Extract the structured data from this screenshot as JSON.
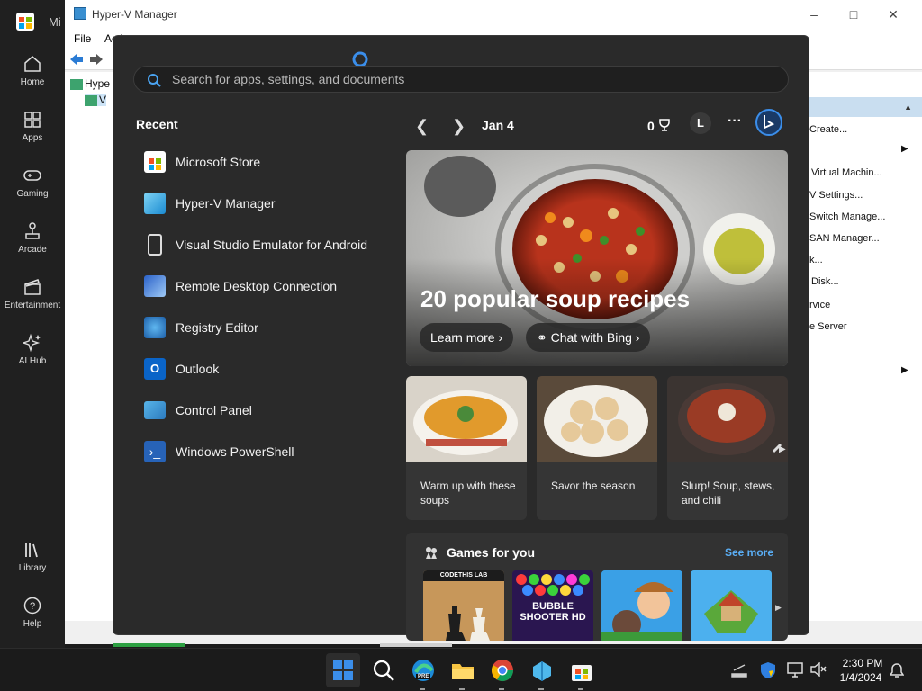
{
  "store": {
    "title": "Mi",
    "nav": [
      {
        "label": "Home",
        "icon": "home-icon"
      },
      {
        "label": "Apps",
        "icon": "apps-icon"
      },
      {
        "label": "Gaming",
        "icon": "gaming-icon"
      },
      {
        "label": "Arcade",
        "icon": "arcade-icon"
      },
      {
        "label": "Entertainment",
        "icon": "entertainment-icon"
      },
      {
        "label": "AI Hub",
        "icon": "ai-hub-icon"
      }
    ],
    "bottom_nav": [
      {
        "label": "Library",
        "icon": "library-icon"
      },
      {
        "label": "Help",
        "icon": "help-icon"
      }
    ]
  },
  "hyperv": {
    "title": "Hyper-V Manager",
    "menu": [
      "File",
      "Acti"
    ],
    "tree": [
      "Hype",
      "V"
    ],
    "actions": [
      "Create...",
      "Virtual Machin...",
      "V Settings...",
      "Switch Manage...",
      "SAN Manager...",
      "k...",
      "Disk...",
      "rvice",
      "e Server"
    ]
  },
  "start": {
    "search_placeholder": "Search for apps, settings, and documents",
    "recent_title": "Recent",
    "recent": [
      {
        "label": "Microsoft Store",
        "icon": "microsoft-store-icon"
      },
      {
        "label": "Hyper-V Manager",
        "icon": "hyperv-icon"
      },
      {
        "label": "Visual Studio Emulator for Android",
        "icon": "emulator-icon"
      },
      {
        "label": "Remote Desktop Connection",
        "icon": "remote-desktop-icon"
      },
      {
        "label": "Registry Editor",
        "icon": "registry-editor-icon"
      },
      {
        "label": "Outlook",
        "icon": "outlook-icon"
      },
      {
        "label": "Control Panel",
        "icon": "control-panel-icon"
      },
      {
        "label": "Windows PowerShell",
        "icon": "powershell-icon"
      }
    ],
    "date": "Jan 4",
    "rewards": "0",
    "avatar": "L",
    "more": "···",
    "hero": {
      "title": "20 popular soup recipes",
      "learn_more": "Learn more",
      "chat": "Chat with Bing"
    },
    "cards": [
      {
        "caption": "Warm up with these soups"
      },
      {
        "caption": "Savor the season"
      },
      {
        "caption": "Slurp! Soup, stews, and chili"
      }
    ],
    "games": {
      "title": "Games for you",
      "see_more": "See more",
      "tiles": [
        {
          "label": "CODETHIS LAB"
        },
        {
          "label": "BUBBLE SHOOTER HD"
        },
        {
          "label": ""
        },
        {
          "label": ""
        }
      ]
    }
  },
  "taskbar": {
    "time": "2:30 PM",
    "date": "1/4/2024",
    "pre_badge": "PRE"
  },
  "colors": {
    "accent": "#3b8eea",
    "start_bg": "#2a2a2a",
    "taskbar_bg": "#1b1b1b"
  }
}
